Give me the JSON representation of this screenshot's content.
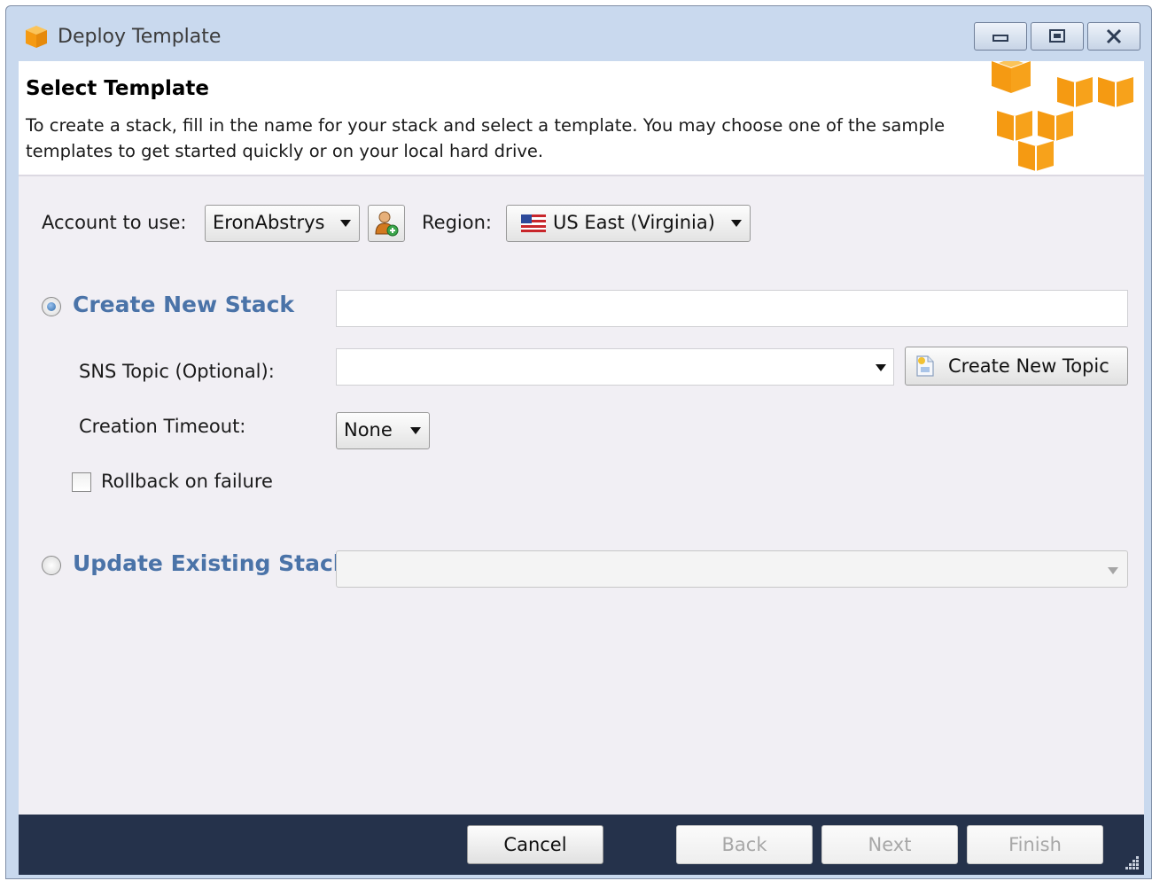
{
  "window": {
    "title": "Deploy Template",
    "icon": "aws-cube-icon",
    "controls": {
      "minimize": "minimize-icon",
      "maximize": "maximize-icon",
      "close": "close-icon"
    }
  },
  "header": {
    "title": "Select Template",
    "description": "To create a stack, fill in the name for your stack and select a template. You may choose one of the sample templates to get started quickly or on your local hard drive.",
    "logo": "aws-cubes-logo"
  },
  "account": {
    "label": "Account to use:",
    "value": "EronAbstrys",
    "add_account_icon": "add-user-icon"
  },
  "region": {
    "label": "Region:",
    "value": "US East (Virginia)",
    "flag": "us-flag-icon"
  },
  "create_stack": {
    "label": "Create New Stack",
    "selected": true,
    "stack_name_value": "",
    "sns_label": "SNS Topic (Optional):",
    "sns_value": "",
    "create_topic_label": "Create New Topic",
    "timeout_label": "Creation Timeout:",
    "timeout_value": "None",
    "rollback_label": "Rollback on failure",
    "rollback_checked": false
  },
  "update_stack": {
    "label": "Update Existing Stack",
    "selected": false,
    "value": ""
  },
  "footer": {
    "cancel": "Cancel",
    "back": "Back",
    "next": "Next",
    "finish": "Finish"
  },
  "colors": {
    "accent_label": "#4a73a8",
    "footer_bg": "#25324b",
    "aws_orange": "#f7a21b"
  }
}
